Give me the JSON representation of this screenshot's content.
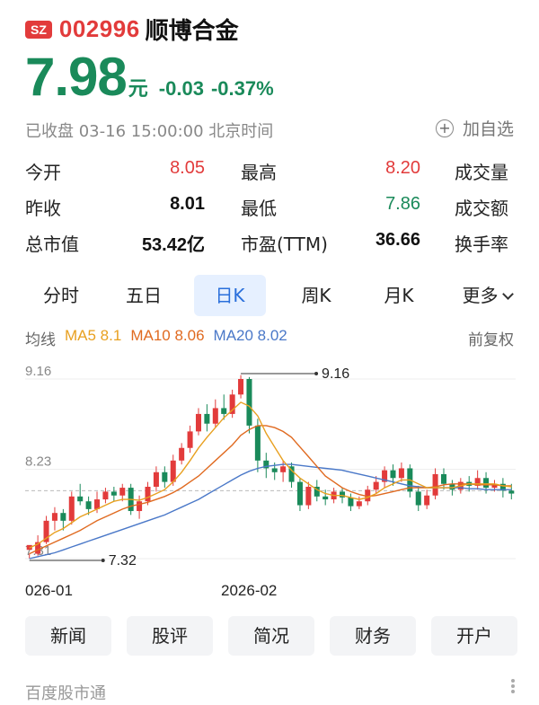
{
  "header": {
    "exchange": "SZ",
    "code": "002996",
    "name": "顺博合金"
  },
  "quote": {
    "price": "7.98",
    "unit": "元",
    "change": "-0.03",
    "change_pct": "-0.37%"
  },
  "status": "已收盘 03-16 15:00:00 北京时间",
  "watch_label": "加自选",
  "stats": [
    {
      "label1": "今开",
      "value1": "8.05",
      "label2": "最高",
      "value2": "8.20",
      "label3": "成交量"
    },
    {
      "label1": "昨收",
      "value1": "8.01",
      "label2": "最低",
      "value2": "7.86",
      "label3": "成交额"
    },
    {
      "label1": "总市值",
      "value1": "53.42亿",
      "label2": "市盈(TTM)",
      "value2": "36.66",
      "label3": "换手率"
    }
  ],
  "tabs": [
    "分时",
    "五日",
    "日K",
    "周K",
    "月K",
    "更多"
  ],
  "active_tab": "日K",
  "ma": {
    "label": "均线",
    "ma5": "MA5 8.1",
    "ma10": "MA10 8.06",
    "ma20": "MA20 8.02"
  },
  "adjust_label": "前复权",
  "chart_data": {
    "type": "candlestick",
    "y_ticks": [
      "9.16",
      "8.23",
      "7.31"
    ],
    "max_marker": "9.16",
    "min_marker": "7.32",
    "x_labels": [
      "026-01",
      "2026-02"
    ],
    "ylim": [
      7.31,
      9.16
    ],
    "reference_price": 8.01,
    "colors": {
      "up": "#e23b3b",
      "down": "#1a8a5a",
      "ma5": "#e8a020",
      "ma10": "#e06a20",
      "ma20": "#4a78c8"
    },
    "candles": [
      [
        7.4,
        7.45,
        7.36,
        7.31
      ],
      [
        7.36,
        7.48,
        7.55,
        7.34
      ],
      [
        7.48,
        7.7,
        7.75,
        7.46
      ],
      [
        7.7,
        7.78,
        7.84,
        7.6
      ],
      [
        7.78,
        7.7,
        7.82,
        7.6
      ],
      [
        7.7,
        7.95,
        8.0,
        7.66
      ],
      [
        7.95,
        7.9,
        8.08,
        7.86
      ],
      [
        7.9,
        7.82,
        7.95,
        7.76
      ],
      [
        7.82,
        7.92,
        8.0,
        7.78
      ],
      [
        7.92,
        8.0,
        8.04,
        7.88
      ],
      [
        8.0,
        7.96,
        8.05,
        7.9
      ],
      [
        7.96,
        8.04,
        8.08,
        7.9
      ],
      [
        8.04,
        7.8,
        8.08,
        7.76
      ],
      [
        7.8,
        7.9,
        7.96,
        7.72
      ],
      [
        7.9,
        8.05,
        8.1,
        7.86
      ],
      [
        8.05,
        8.2,
        8.26,
        8.0
      ],
      [
        8.2,
        8.1,
        8.26,
        8.04
      ],
      [
        8.1,
        8.32,
        8.38,
        8.06
      ],
      [
        8.32,
        8.45,
        8.5,
        8.28
      ],
      [
        8.45,
        8.62,
        8.68,
        8.4
      ],
      [
        8.62,
        8.8,
        8.86,
        8.58
      ],
      [
        8.8,
        8.7,
        8.9,
        8.62
      ],
      [
        8.7,
        8.86,
        8.95,
        8.66
      ],
      [
        8.86,
        8.8,
        9.0,
        8.74
      ],
      [
        8.8,
        9.0,
        9.05,
        8.76
      ],
      [
        9.0,
        9.16,
        9.2,
        8.96
      ],
      [
        9.16,
        8.68,
        9.18,
        8.6
      ],
      [
        8.68,
        8.32,
        8.75,
        8.2
      ],
      [
        8.32,
        8.24,
        8.4,
        8.14
      ],
      [
        8.24,
        8.2,
        8.3,
        8.12
      ],
      [
        8.2,
        8.26,
        8.32,
        8.1
      ],
      [
        8.26,
        8.1,
        8.3,
        8.04
      ],
      [
        8.1,
        7.86,
        8.14,
        7.8
      ],
      [
        7.86,
        8.05,
        8.1,
        7.82
      ],
      [
        8.05,
        7.95,
        8.12,
        7.9
      ],
      [
        7.95,
        7.92,
        8.02,
        7.86
      ],
      [
        7.92,
        8.0,
        8.04,
        7.88
      ],
      [
        8.0,
        7.94,
        8.04,
        7.88
      ],
      [
        7.94,
        7.85,
        7.98,
        7.8
      ],
      [
        7.85,
        7.9,
        7.95,
        7.82
      ],
      [
        7.9,
        8.02,
        8.06,
        7.86
      ],
      [
        8.02,
        8.1,
        8.16,
        7.98
      ],
      [
        8.1,
        8.22,
        8.26,
        8.04
      ],
      [
        8.22,
        8.14,
        8.28,
        8.06
      ],
      [
        8.14,
        8.24,
        8.3,
        8.1
      ],
      [
        8.24,
        8.0,
        8.28,
        7.94
      ],
      [
        8.0,
        7.86,
        8.06,
        7.8
      ],
      [
        7.86,
        7.96,
        8.02,
        7.82
      ],
      [
        7.96,
        8.18,
        8.24,
        7.92
      ],
      [
        8.18,
        8.08,
        8.24,
        8.02
      ],
      [
        8.08,
        8.02,
        8.12,
        7.96
      ],
      [
        8.02,
        8.1,
        8.14,
        7.98
      ],
      [
        8.1,
        8.06,
        8.16,
        8.0
      ],
      [
        8.06,
        8.14,
        8.22,
        8.02
      ],
      [
        8.14,
        8.04,
        8.2,
        7.98
      ],
      [
        8.04,
        8.08,
        8.12,
        8.0
      ],
      [
        8.08,
        8.01,
        8.14,
        7.94
      ],
      [
        8.01,
        7.98,
        8.08,
        7.92
      ]
    ],
    "ma5": [
      7.42,
      7.46,
      7.52,
      7.58,
      7.62,
      7.68,
      7.74,
      7.78,
      7.82,
      7.86,
      7.9,
      7.92,
      7.92,
      7.91,
      7.94,
      7.98,
      8.02,
      8.1,
      8.2,
      8.32,
      8.45,
      8.56,
      8.66,
      8.76,
      8.84,
      8.92,
      8.88,
      8.78,
      8.6,
      8.46,
      8.32,
      8.22,
      8.14,
      8.08,
      8.02,
      7.98,
      7.96,
      7.96,
      7.94,
      7.92,
      7.94,
      7.98,
      8.04,
      8.08,
      8.12,
      8.12,
      8.08,
      8.04,
      8.04,
      8.04,
      8.04,
      8.06,
      8.08,
      8.08,
      8.08,
      8.08,
      8.06,
      8.05
    ],
    "ma10": [
      7.36,
      7.4,
      7.44,
      7.48,
      7.52,
      7.56,
      7.6,
      7.65,
      7.7,
      7.74,
      7.78,
      7.82,
      7.85,
      7.87,
      7.89,
      7.92,
      7.95,
      7.99,
      8.04,
      8.1,
      8.16,
      8.24,
      8.32,
      8.4,
      8.48,
      8.58,
      8.64,
      8.68,
      8.68,
      8.66,
      8.62,
      8.56,
      8.46,
      8.36,
      8.26,
      8.16,
      8.1,
      8.04,
      8.0,
      7.97,
      7.95,
      7.96,
      7.98,
      8.0,
      8.02,
      8.04,
      8.04,
      8.04,
      8.05,
      8.07,
      8.08,
      8.08,
      8.08,
      8.07,
      8.07,
      8.07,
      8.06,
      8.06
    ],
    "ma20": [
      7.31,
      7.33,
      7.35,
      7.37,
      7.4,
      7.43,
      7.46,
      7.49,
      7.52,
      7.55,
      7.58,
      7.61,
      7.64,
      7.67,
      7.7,
      7.73,
      7.76,
      7.8,
      7.84,
      7.88,
      7.92,
      7.97,
      8.02,
      8.07,
      8.12,
      8.17,
      8.21,
      8.24,
      8.26,
      8.27,
      8.28,
      8.28,
      8.27,
      8.26,
      8.25,
      8.24,
      8.23,
      8.22,
      8.2,
      8.18,
      8.16,
      8.14,
      8.12,
      8.1,
      8.08,
      8.06,
      8.05,
      8.04,
      8.04,
      8.04,
      8.04,
      8.04,
      8.03,
      8.03,
      8.02,
      8.02,
      8.02,
      8.02
    ]
  },
  "actions": [
    "新闻",
    "股评",
    "简况",
    "财务",
    "开户"
  ],
  "footer": "百度股市通"
}
